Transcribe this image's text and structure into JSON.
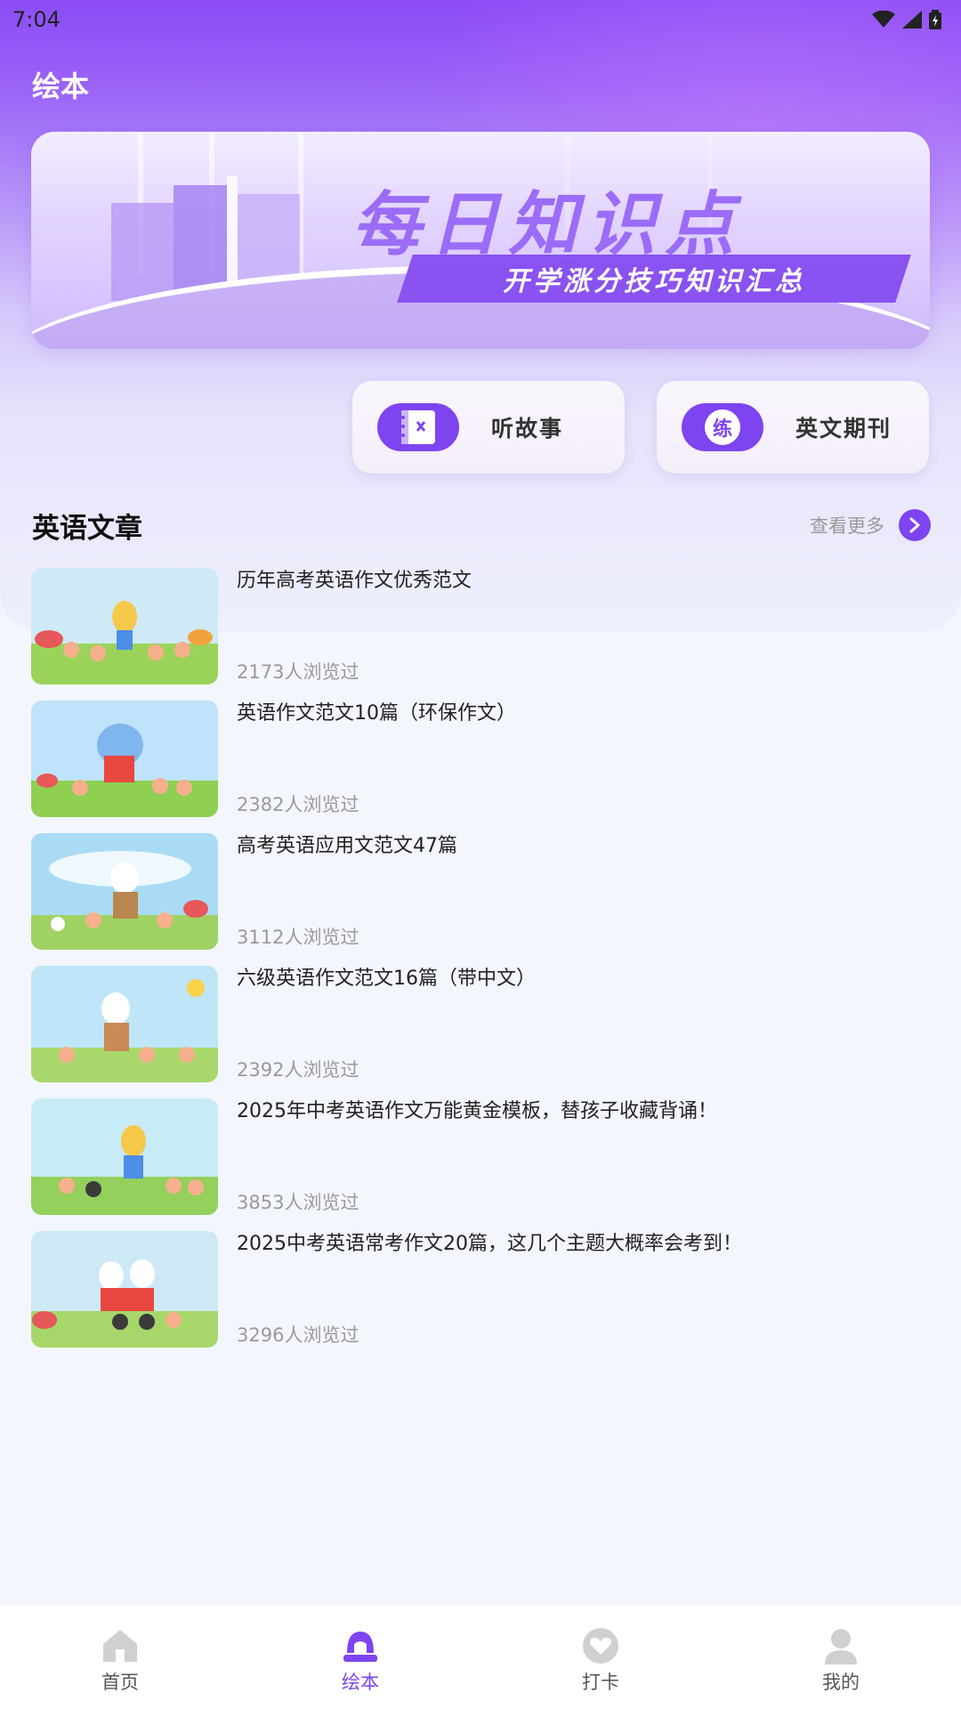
{
  "status": {
    "time": "7:04"
  },
  "header": {
    "title": "绘本"
  },
  "banner": {
    "title": "每日知识点",
    "subtitle": "开学涨分技巧知识汇总"
  },
  "quick_actions": [
    {
      "label": "听故事",
      "icon": "notebook-icon",
      "icon_text": ""
    },
    {
      "label": "英文期刊",
      "icon": "practice-badge-icon",
      "icon_text": "练"
    }
  ],
  "section": {
    "title": "英语文章",
    "more": "查看更多"
  },
  "articles": [
    {
      "title": "历年高考英语作文优秀范文",
      "views": "2173人浏览过",
      "thumb": "bunny-reading-illustration"
    },
    {
      "title": "英语作文范文10篇（环保作文）",
      "views": "2382人浏览过",
      "thumb": "elephant-reading-illustration"
    },
    {
      "title": "高考英语应用文范文47篇",
      "views": "3112人浏览过",
      "thumb": "bunny-teacher-illustration"
    },
    {
      "title": "六级英语作文范文16篇（带中文）",
      "views": "2392人浏览过",
      "thumb": "bunny-storytime-illustration"
    },
    {
      "title": "2025年中考英语作文万能黄金模板，替孩子收藏背诵！",
      "views": "3853人浏览过",
      "thumb": "bunny-book-illustration"
    },
    {
      "title": "2025中考英语常考作文20篇，这几个主题大概率会考到！",
      "views": "3296人浏览过",
      "thumb": "bunnies-reading-illustration"
    }
  ],
  "tabbar": [
    {
      "label": "首页",
      "icon": "home-icon",
      "active": false
    },
    {
      "label": "绘本",
      "icon": "picture-book-icon",
      "active": true
    },
    {
      "label": "打卡",
      "icon": "heart-icon",
      "active": false
    },
    {
      "label": "我的",
      "icon": "profile-icon",
      "active": false
    }
  ],
  "colors": {
    "accent": "#7d44f0",
    "header_top": "#8b4cf6",
    "background": "#f4f6fd"
  }
}
